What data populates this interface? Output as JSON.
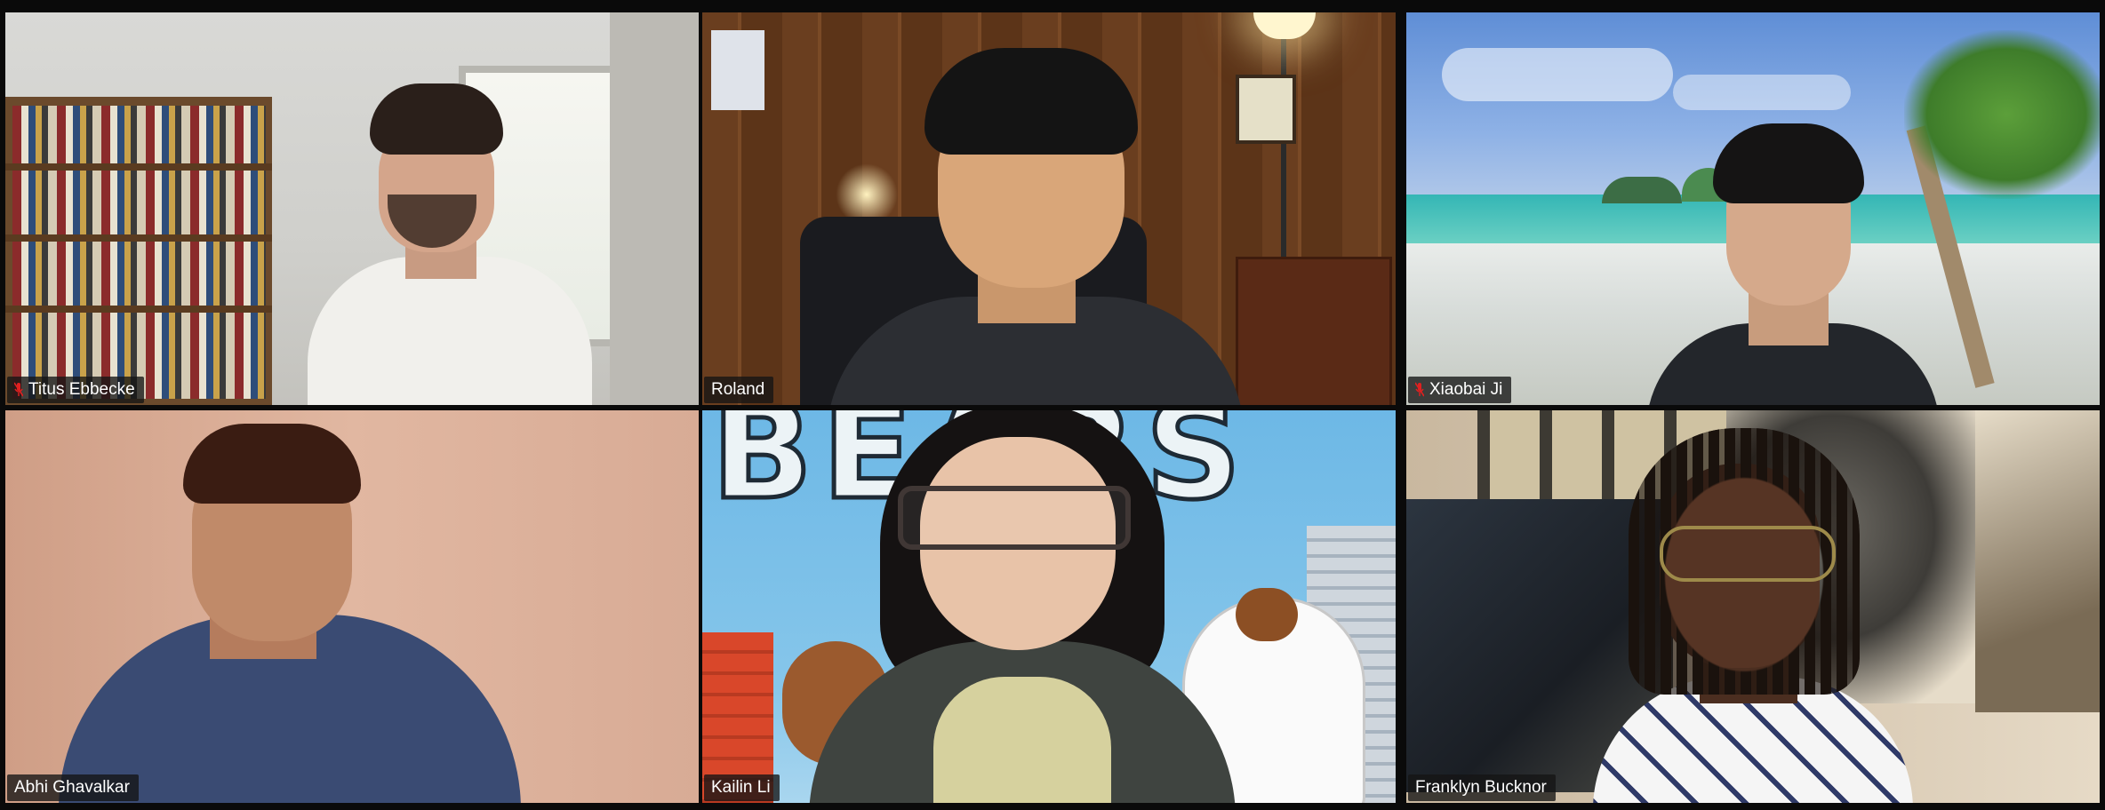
{
  "meeting": {
    "participants": [
      {
        "name": "Titus Ebbecke",
        "muted": true
      },
      {
        "name": "Roland",
        "muted": false,
        "active_speaker": true
      },
      {
        "name": "Xiaobai Ji",
        "muted": true
      },
      {
        "name": "Abhi Ghavalkar",
        "muted": false
      },
      {
        "name": "Kailin Li",
        "muted": false
      },
      {
        "name": "Franklyn Bucknor",
        "muted": false
      }
    ],
    "background_text": "BEARS"
  },
  "colors": {
    "active_speaker_border": "#c8e35a",
    "mute_icon": "#e02020",
    "nametag_bg": "rgba(20,20,20,0.78)"
  },
  "icons": {
    "muted": "mic-muted-icon"
  }
}
